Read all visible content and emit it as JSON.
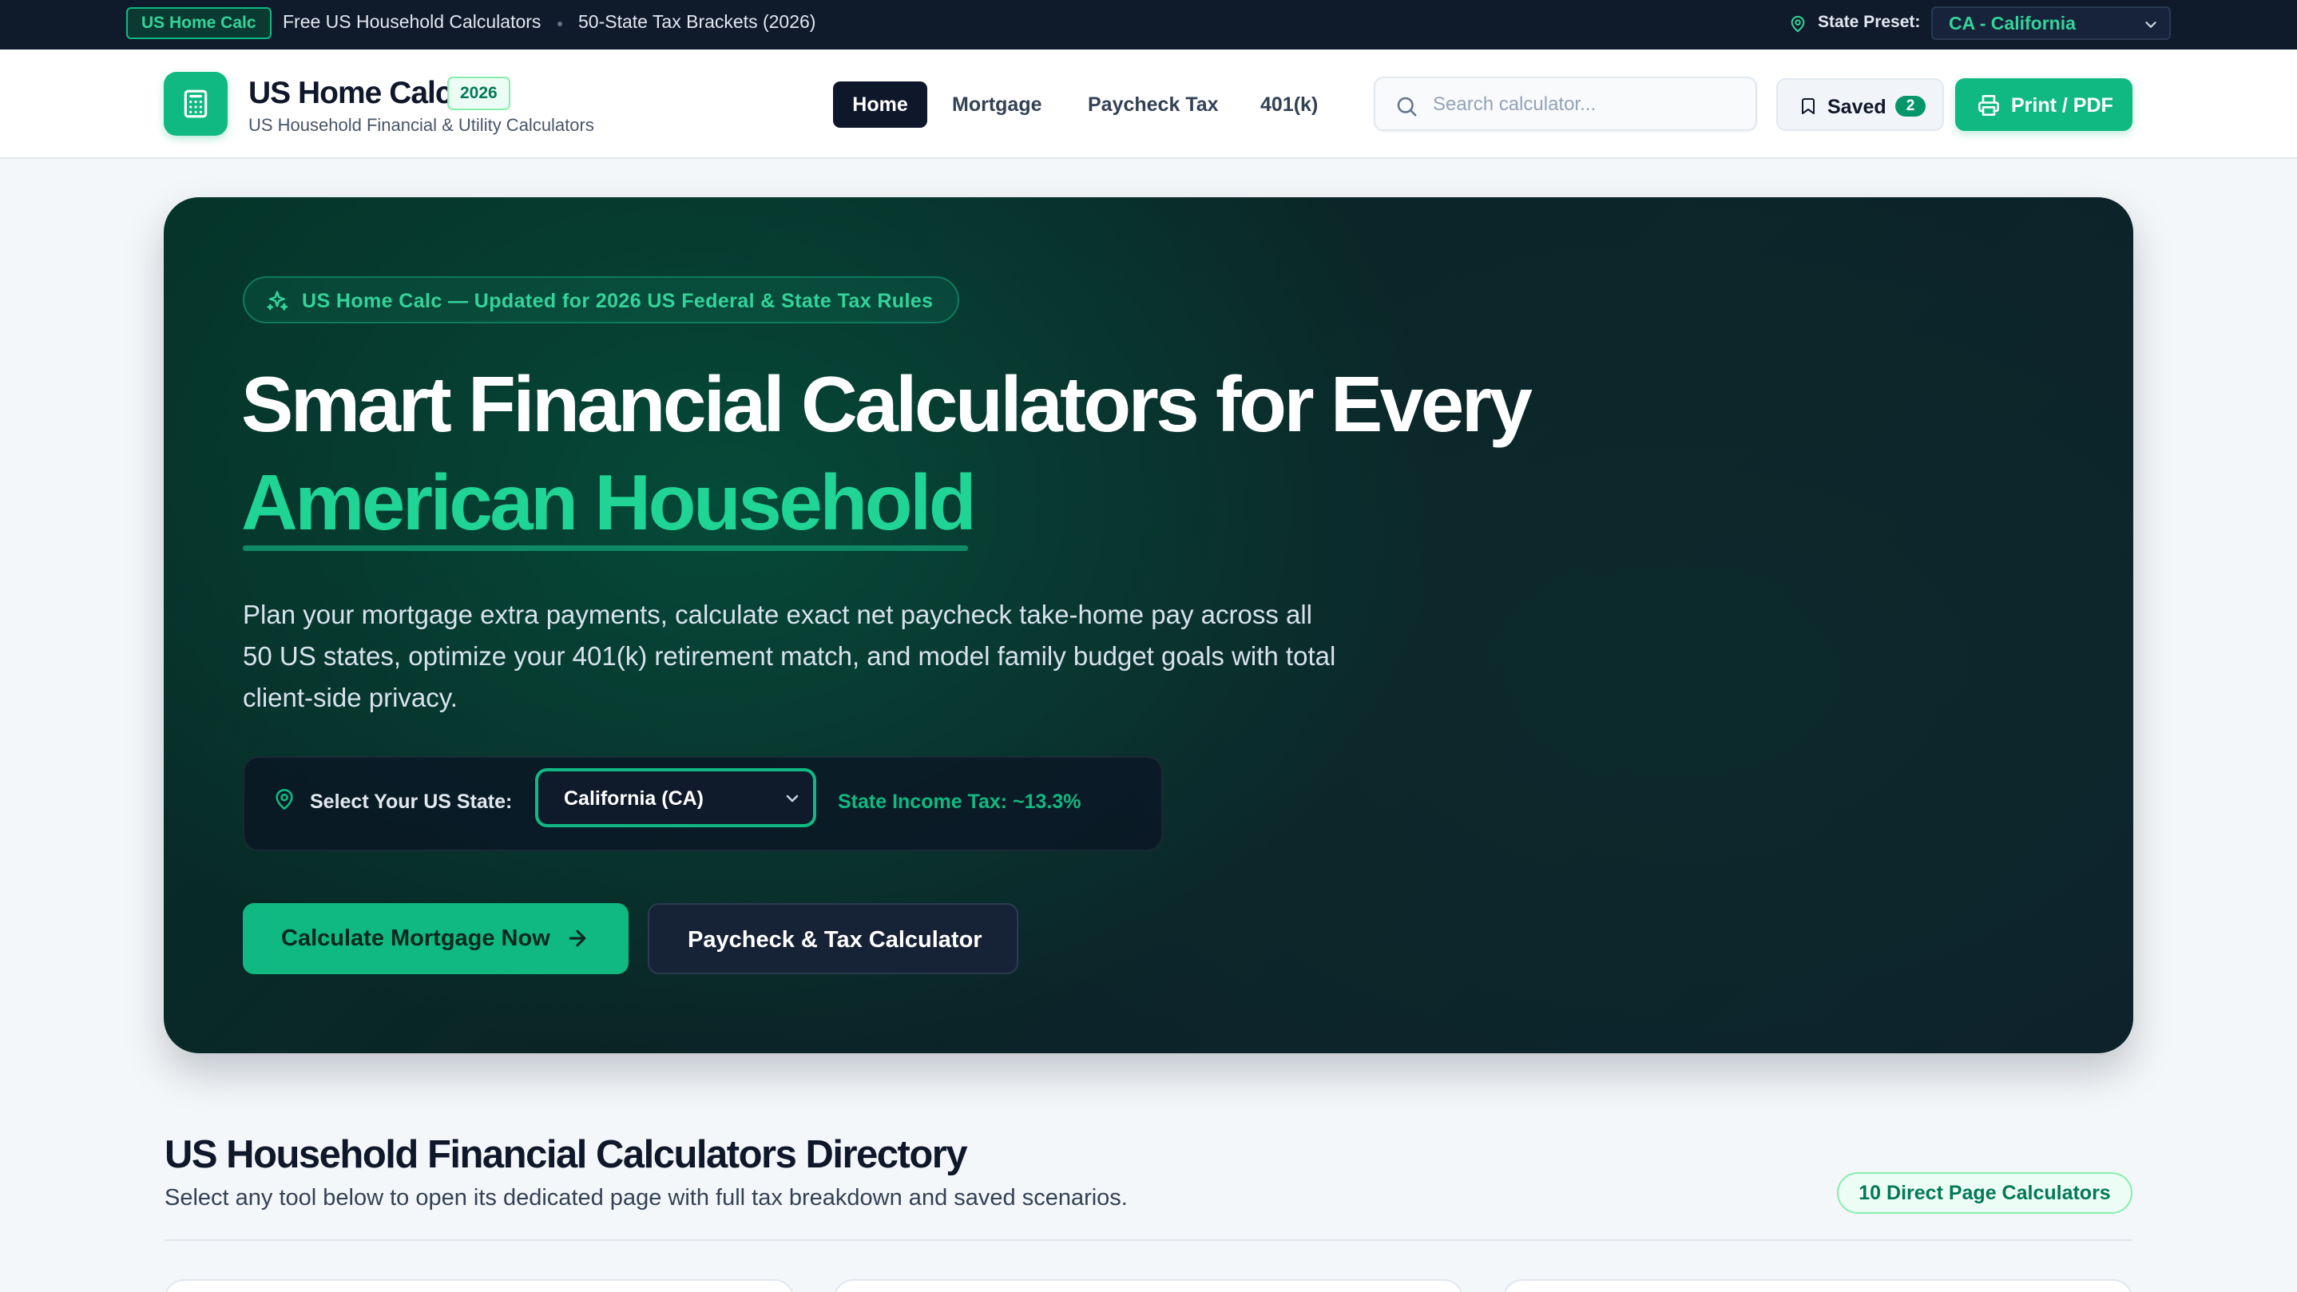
{
  "topbar": {
    "badge": "US Home Calc",
    "link1": "Free US Household Calculators",
    "link2": "50-State Tax Brackets (2026)",
    "state_label": "State Preset:",
    "state_value": "CA - California"
  },
  "header": {
    "brand_name": "US Home Calc",
    "year_badge": "2026",
    "brand_sub": "US Household Financial & Utility Calculators",
    "nav": [
      "Home",
      "Mortgage",
      "Paycheck Tax",
      "401(k)"
    ],
    "search_placeholder": "Search calculator...",
    "saved_label": "Saved",
    "saved_count": "2",
    "print_label": "Print / PDF"
  },
  "hero": {
    "pill": "US Home Calc — Updated for 2026 US Federal & State Tax Rules",
    "title_line1": "Smart Financial Calculators for Every",
    "title_line2": "American Household",
    "paragraph": "Plan your mortgage extra payments, calculate exact net paycheck take-home pay across all 50 US states, optimize your 401(k) retirement match, and model family budget goals with total client-side privacy.",
    "state_label": "Select Your US State:",
    "state_value": "California (CA)",
    "state_tax": "State Income Tax: ~13.3%",
    "primary_button": "Calculate Mortgage Now",
    "secondary_button": "Paycheck & Tax Calculator"
  },
  "directory": {
    "title": "US Household Financial Calculators Directory",
    "subtitle": "Select any tool below to open its dedicated page with full tax breakdown and saved scenarios.",
    "badge": "10 Direct Page Calculators"
  },
  "colors": {
    "accent": "#10b981",
    "dark": "#0f172a",
    "topbar": "#0f1a2b"
  },
  "icons": {
    "logo": "calculator-icon",
    "pin": "map-pin-icon",
    "search": "search-icon",
    "saved": "bookmark-icon",
    "print": "printer-icon",
    "pill": "sparkles-icon",
    "arrow": "arrow-right-icon",
    "dropdown": "chevron-down-icon"
  }
}
